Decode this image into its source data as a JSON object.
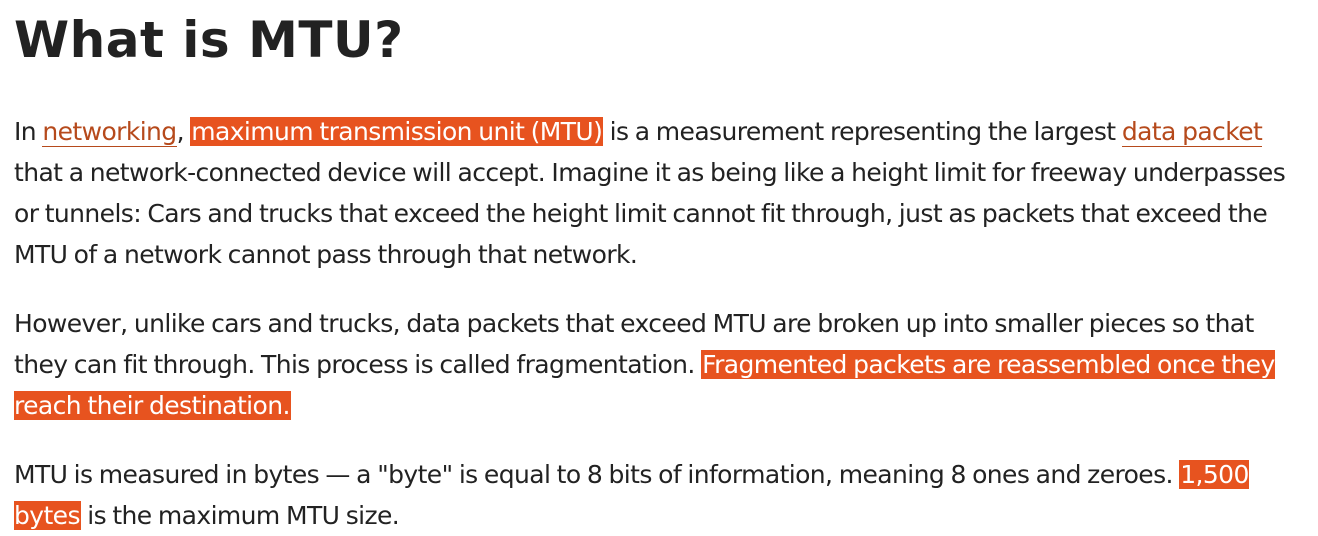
{
  "heading": "What is MTU?",
  "colors": {
    "highlight": "#e7531f",
    "link": "#b64a1c",
    "text": "#222222"
  },
  "paragraphs": [
    {
      "t1": "In ",
      "link_networking": "networking",
      "t2": ", ",
      "highlight_mtu": "maximum transmission unit (MTU)",
      "t3": " is a measurement representing the largest ",
      "link_data_packet": "data packet",
      "t4": " that a network-connected device will accept. Imagine it as being like a height limit for freeway underpasses or tunnels: Cars and trucks that exceed the height limit cannot fit through, just as packets that exceed the MTU of a network cannot pass through that network."
    },
    {
      "t1": "However, unlike cars and trucks, data packets that exceed MTU are broken up into smaller pieces so that they can fit through. This process is called fragmentation. ",
      "highlight": "Fragmented packets are reassembled once they reach their destination."
    },
    {
      "t1": "MTU is measured in bytes — a \"byte\" is equal to 8 bits of information, meaning 8 ones and zeroes. ",
      "highlight": "1,500 bytes",
      "t2": " is the maximum MTU size."
    }
  ]
}
